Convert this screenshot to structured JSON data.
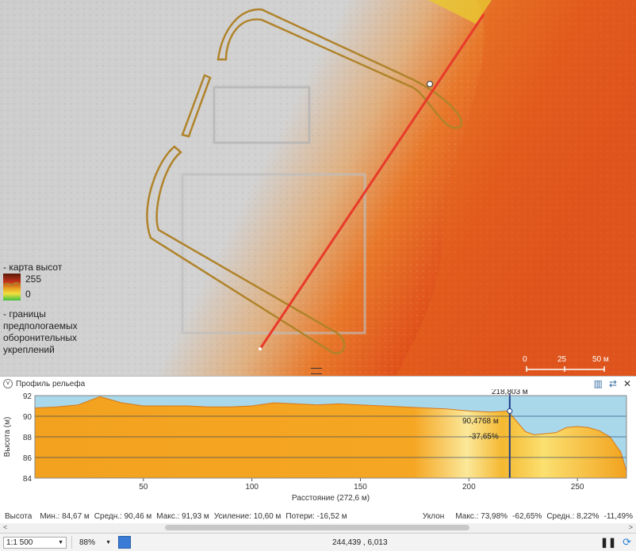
{
  "legend": {
    "title": "- карта высот",
    "max": "255",
    "min": "0",
    "boundary": "- границы предпологаемых оборонительных укреплений"
  },
  "map_scale": {
    "t0": "0",
    "t1": "25",
    "t2": "50 м"
  },
  "profile": {
    "title": "Профиль рельефа",
    "cursor_label": "218,803 м",
    "readout_height": "90,4768 м",
    "readout_slope": "-37,65%"
  },
  "chart_data": {
    "type": "area",
    "xlabel": "Расстояние (272,6 м)",
    "ylabel": "Высота (м)",
    "xlim": [
      0,
      272.6
    ],
    "ylim": [
      84,
      92
    ],
    "x_ticks": [
      "50",
      "100",
      "150",
      "200",
      "250"
    ],
    "y_ticks": [
      "84",
      "86",
      "88",
      "90",
      "92"
    ],
    "cursor_x": 218.8,
    "x": [
      0,
      10,
      20,
      30,
      40,
      50,
      60,
      70,
      80,
      90,
      100,
      110,
      120,
      130,
      140,
      150,
      160,
      170,
      180,
      190,
      200,
      210,
      218,
      222,
      226,
      230,
      235,
      240,
      245,
      250,
      255,
      260,
      265,
      270,
      272.6
    ],
    "y": [
      90.8,
      90.9,
      91.1,
      91.9,
      91.3,
      91.0,
      91.0,
      91.0,
      90.9,
      90.9,
      91.0,
      91.3,
      91.2,
      91.1,
      91.2,
      91.1,
      91.0,
      90.9,
      90.8,
      90.7,
      90.5,
      90.4,
      90.5,
      89.5,
      88.5,
      88.2,
      88.3,
      88.4,
      88.9,
      89.0,
      88.9,
      88.6,
      88.0,
      86.5,
      84.7
    ]
  },
  "stats": {
    "height_label": "Высота",
    "min": "Мин.: 84,67 м",
    "mean": "Средн.: 90,46 м",
    "max": "Макс.: 91,93 м",
    "gain": "Усиление: 10,60 м",
    "loss": "Потери: -16,52 м",
    "slope_label": "Уклон",
    "slope_max": "Макс.: 73,98%",
    "slope_min": "-62,65%",
    "slope_mean": "Средн.: 8,22%",
    "slope_min2": "-11,49%"
  },
  "status": {
    "scale": "1:1 500",
    "zoom": "88%",
    "coords": "244,439 , 6,013"
  }
}
